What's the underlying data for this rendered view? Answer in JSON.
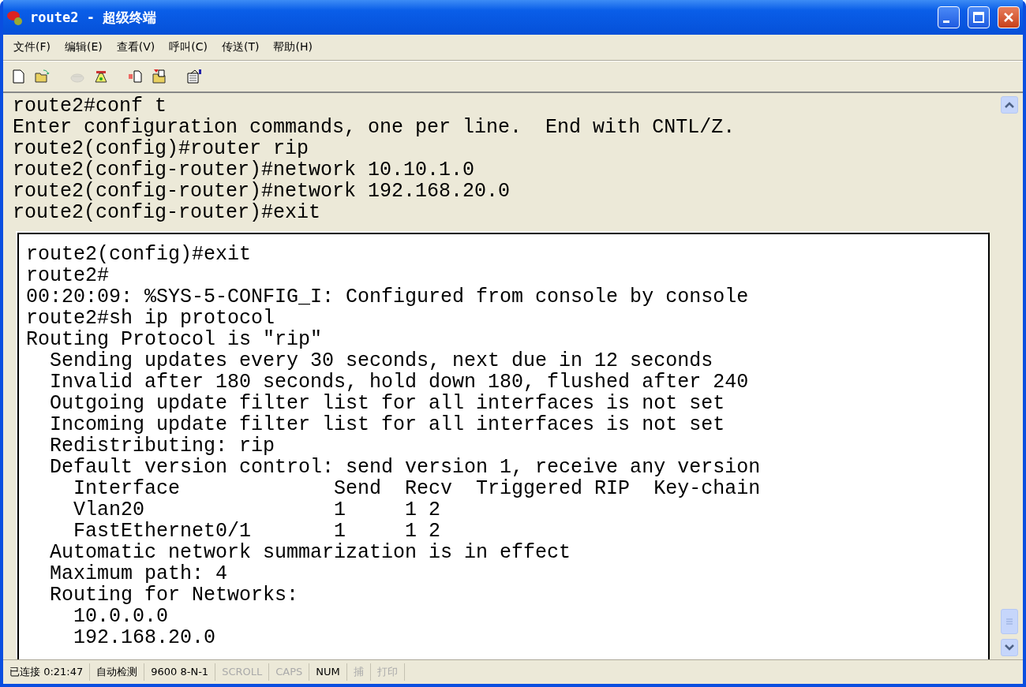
{
  "window": {
    "title": "route2 - 超级终端"
  },
  "menu": [
    "文件(F)",
    "编辑(E)",
    "查看(V)",
    "呼叫(C)",
    "传送(T)",
    "帮助(H)"
  ],
  "toolbar": [
    {
      "kind": "new",
      "disabled": false
    },
    {
      "kind": "open",
      "disabled": false
    },
    {
      "kind": "disconnect",
      "disabled": true
    },
    {
      "kind": "dial",
      "disabled": false
    },
    {
      "kind": "send",
      "disabled": false
    },
    {
      "kind": "receive",
      "disabled": false
    },
    {
      "kind": "properties",
      "disabled": false
    }
  ],
  "terminal": {
    "lines": [
      "route2#conf t",
      "Enter configuration commands, one per line.  End with CNTL/Z.",
      "route2(config)#router rip",
      "route2(config-router)#network 10.10.1.0",
      "route2(config-router)#network 192.168.20.0",
      "route2(config-router)#exit"
    ],
    "inset_lines": [
      "route2(config)#exit",
      "route2#",
      "00:20:09: %SYS-5-CONFIG_I: Configured from console by console",
      "route2#sh ip protocol",
      "Routing Protocol is \"rip\"",
      "  Sending updates every 30 seconds, next due in 12 seconds",
      "  Invalid after 180 seconds, hold down 180, flushed after 240",
      "  Outgoing update filter list for all interfaces is not set",
      "  Incoming update filter list for all interfaces is not set",
      "  Redistributing: rip",
      "  Default version control: send version 1, receive any version",
      "    Interface             Send  Recv  Triggered RIP  Key-chain",
      "    Vlan20                1     1 2",
      "    FastEthernet0/1       1     1 2",
      "  Automatic network summarization is in effect",
      "  Maximum path: 4",
      "  Routing for Networks:",
      "    10.0.0.0",
      "    192.168.20.0"
    ]
  },
  "status_bar": [
    {
      "text": "已连接 0:21:47",
      "on": true
    },
    {
      "text": "自动检测",
      "on": true
    },
    {
      "text": "9600 8-N-1",
      "on": true
    },
    {
      "text": "SCROLL",
      "on": false
    },
    {
      "text": "CAPS",
      "on": false
    },
    {
      "text": "NUM",
      "on": true
    },
    {
      "text": "捕",
      "on": false
    },
    {
      "text": "打印",
      "on": false
    }
  ]
}
